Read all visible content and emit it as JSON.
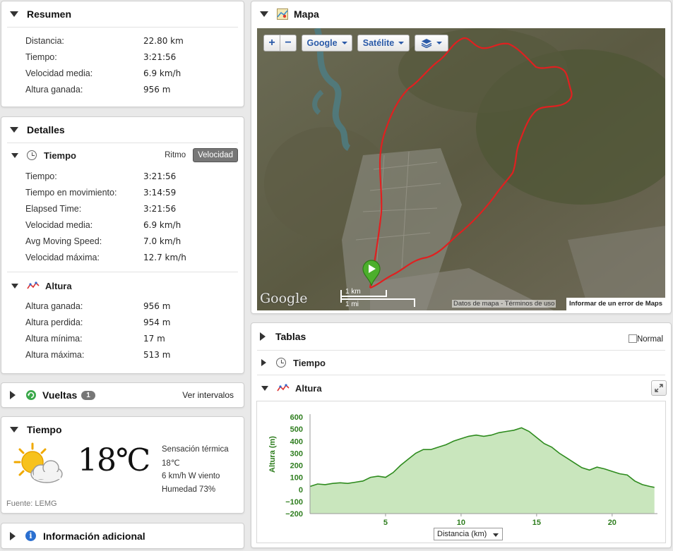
{
  "resumen": {
    "title": "Resumen",
    "rows": [
      {
        "label": "Distancia:",
        "value": "22.80 km"
      },
      {
        "label": "Tiempo:",
        "value": "3:21:56"
      },
      {
        "label": "Velocidad media:",
        "value": "6.9 km/h"
      },
      {
        "label": "Altura ganada:",
        "value": "956 m"
      }
    ]
  },
  "detalles": {
    "title": "Detalles",
    "tiempo": {
      "title": "Tiempo",
      "toggle_ritmo": "Ritmo",
      "toggle_velocidad": "Velocidad",
      "rows": [
        {
          "label": "Tiempo:",
          "value": "3:21:56"
        },
        {
          "label": "Tiempo en movimiento:",
          "value": "3:14:59"
        },
        {
          "label": "Elapsed Time:",
          "value": "3:21:56"
        },
        {
          "label": "Velocidad media:",
          "value": "6.9 km/h"
        },
        {
          "label": "Avg Moving Speed:",
          "value": "7.0 km/h"
        },
        {
          "label": "Velocidad máxima:",
          "value": "12.7 km/h"
        }
      ]
    },
    "altura": {
      "title": "Altura",
      "rows": [
        {
          "label": "Altura ganada:",
          "value": "956 m"
        },
        {
          "label": "Altura perdida:",
          "value": "954 m"
        },
        {
          "label": "Altura mínima:",
          "value": "17 m"
        },
        {
          "label": "Altura máxima:",
          "value": "513 m"
        }
      ]
    }
  },
  "vueltas": {
    "title": "Vueltas",
    "count": "1",
    "link": "Ver intervalos"
  },
  "weather": {
    "title": "Tiempo",
    "temperature": "18℃",
    "feels_like_label": "Sensación térmica",
    "feels_like_value": "18℃",
    "wind": "6 km/h W viento",
    "humidity": "Humedad 73%",
    "source": "Fuente: LEMG"
  },
  "info": {
    "title": "Información adicional"
  },
  "map": {
    "title": "Mapa",
    "zoom_in": "+",
    "zoom_out": "−",
    "provider": "Google",
    "map_type": "Satélite",
    "scale_km": "1 km",
    "scale_mi": "1 mi",
    "logo": "Google",
    "attribution": "Datos de mapa - Términos de uso",
    "report": "Informar de un error de Maps"
  },
  "tablas": {
    "title": "Tablas",
    "normal_label": "Normal",
    "tiempo_label": "Tiempo",
    "altura_label": "Altura",
    "x_selector": "Distancia (km)"
  },
  "colors": {
    "route": "#e02020",
    "chart_line": "#2e8b1e",
    "chart_fill": "#c9e6bd",
    "chart_axis_text": "#2e7d1e"
  },
  "chart_data": {
    "type": "area",
    "xlabel": "Distancia (km)",
    "ylabel": "Altura (m)",
    "xlim": [
      0,
      23
    ],
    "ylim": [
      -200,
      600
    ],
    "xticks": [
      "5",
      "10",
      "15",
      "20"
    ],
    "yticks": [
      "600",
      "500",
      "400",
      "300",
      "200",
      "100",
      "0",
      "−100",
      "−200"
    ],
    "x": [
      0,
      0.5,
      1,
      1.5,
      2,
      2.5,
      3,
      3.5,
      4,
      4.5,
      5,
      5.5,
      6,
      6.5,
      7,
      7.5,
      8,
      8.5,
      9,
      9.5,
      10,
      10.5,
      11,
      11.5,
      12,
      12.5,
      13,
      13.5,
      14,
      14.5,
      15,
      15.5,
      16,
      16.5,
      17,
      17.5,
      18,
      18.5,
      19,
      19.5,
      20,
      20.5,
      21,
      21.5,
      22,
      22.5,
      22.8
    ],
    "y": [
      25,
      45,
      40,
      50,
      55,
      50,
      60,
      70,
      100,
      110,
      100,
      140,
      200,
      250,
      300,
      330,
      330,
      350,
      370,
      400,
      420,
      440,
      450,
      440,
      450,
      470,
      480,
      490,
      510,
      480,
      430,
      380,
      350,
      300,
      260,
      220,
      180,
      160,
      185,
      170,
      150,
      130,
      120,
      70,
      40,
      25,
      17
    ]
  }
}
